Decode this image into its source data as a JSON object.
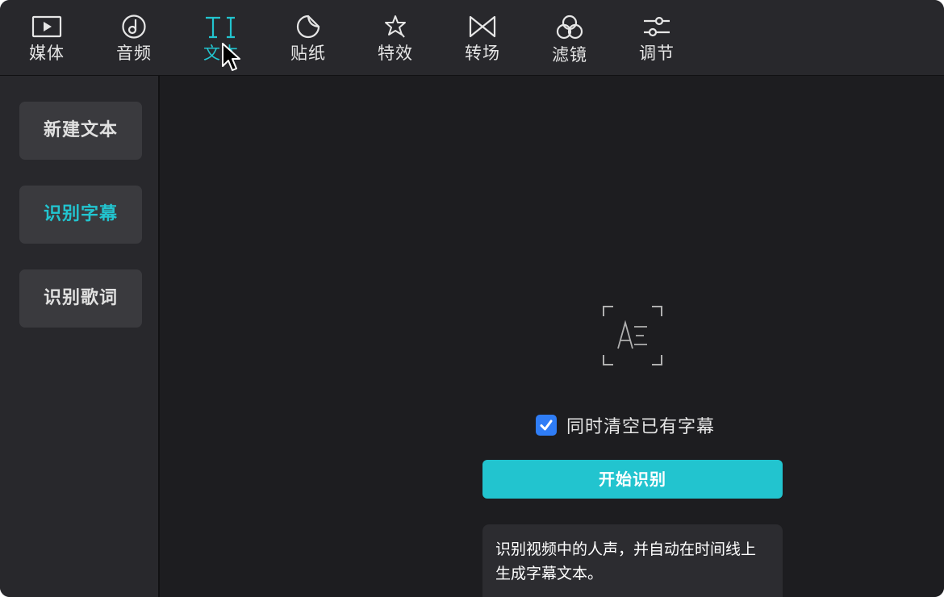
{
  "toolbar": {
    "tabs": [
      {
        "label": "媒体",
        "icon": "media-play-icon"
      },
      {
        "label": "音频",
        "icon": "audio-note-icon"
      },
      {
        "label": "文本",
        "icon": "text-ti-icon",
        "active": true
      },
      {
        "label": "贴纸",
        "icon": "sticker-icon"
      },
      {
        "label": "特效",
        "icon": "effects-star-icon"
      },
      {
        "label": "转场",
        "icon": "transition-bowtie-icon"
      },
      {
        "label": "滤镜",
        "icon": "filter-clouds-icon"
      },
      {
        "label": "调节",
        "icon": "adjust-sliders-icon"
      }
    ],
    "accent_color": "#22c4cf"
  },
  "sidebar": {
    "items": [
      {
        "label": "新建文本",
        "active": false
      },
      {
        "label": "识别字幕",
        "active": true
      },
      {
        "label": "识别歌词",
        "active": false
      }
    ]
  },
  "main": {
    "icon": "auto-caption-recognition-icon",
    "checkbox_label": "同时清空已有字幕",
    "checkbox_checked": true,
    "start_button_label": "开始识别",
    "tip_text": "识别视频中的人声，并自动在时间线上生成字幕文本。"
  }
}
